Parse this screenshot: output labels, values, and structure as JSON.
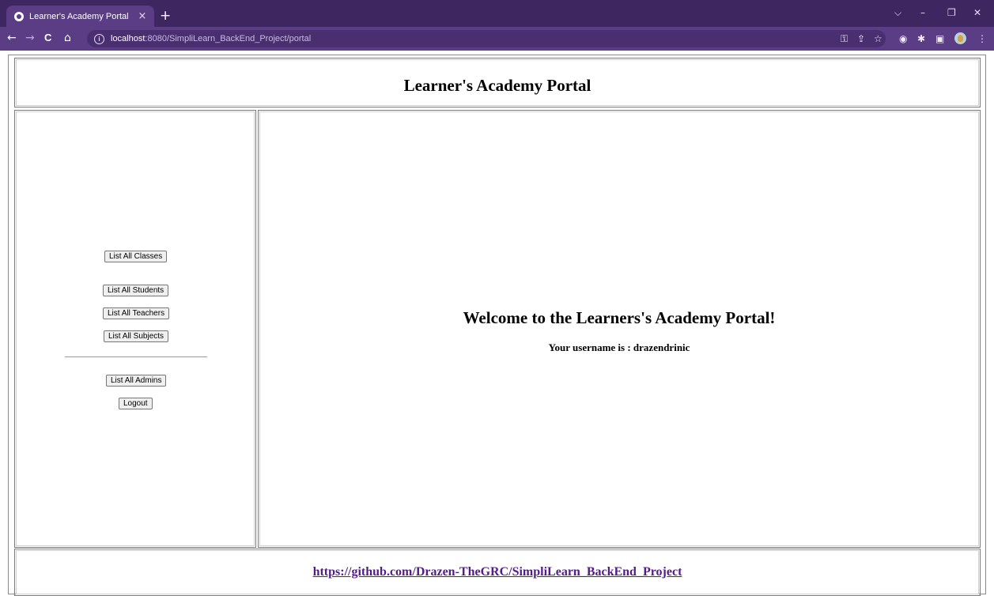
{
  "browser": {
    "tab_title": "Learner's Academy Portal",
    "tab_close": "×",
    "new_tab": "+",
    "url_host": "localhost",
    "url_path": ":8080/SimpliLearn_BackEnd_Project/portal",
    "info_glyph": "i",
    "window_controls": {
      "dropdown": "⌵",
      "minimize": "–",
      "restore": "❐",
      "close": "✕"
    },
    "nav": {
      "back": "←",
      "forward": "→",
      "reload": "C",
      "home": "⌂"
    },
    "toolbar_icons": {
      "key": "⚿",
      "share": "⇪",
      "star": "☆",
      "extension_a": "◉",
      "extensions": "✱",
      "sidepanel": "▣",
      "menu": "⋮"
    }
  },
  "header": {
    "title": "Learner's Academy Portal"
  },
  "sidebar": {
    "buttons": [
      {
        "id": "classes",
        "label": "List All Classes"
      },
      {
        "id": "students",
        "label": "List All Students"
      },
      {
        "id": "teachers",
        "label": "List All Teachers"
      },
      {
        "id": "subjects",
        "label": "List All Subjects"
      },
      {
        "id": "admins",
        "label": "List All Admins"
      },
      {
        "id": "logout",
        "label": "Logout"
      }
    ]
  },
  "main": {
    "welcome": "Welcome to the Learners's Academy Portal!",
    "username_text": "Your username is : drazendrinic"
  },
  "footer": {
    "link_text": "https://github.com/Drazen-TheGRC/SimpliLearn_BackEnd_Project"
  },
  "colors": {
    "tabstrip": "#3e2660",
    "toolbar": "#5a3d85",
    "link": "#551a8b"
  }
}
